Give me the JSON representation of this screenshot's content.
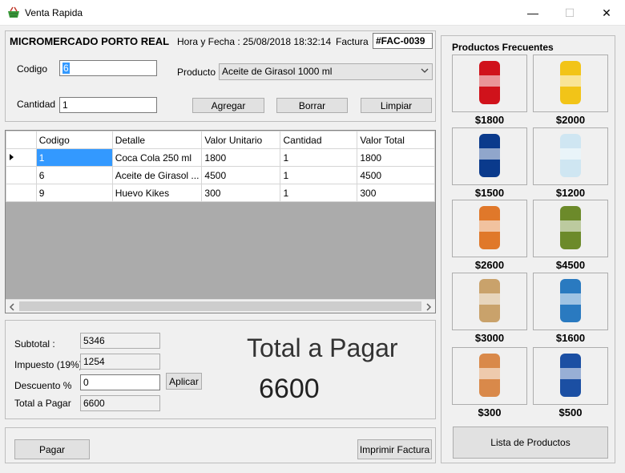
{
  "window": {
    "title": "Venta Rapida",
    "minimize": "—",
    "maximize": "☐",
    "close": "✕"
  },
  "header": {
    "store": "MICROMERCADO PORTO REAL",
    "datetime": "Hora  y Fecha : 25/08/2018 18:32:14",
    "invoice_label": "Factura",
    "invoice_number": "#FAC-0039"
  },
  "form": {
    "codigo_label": "Codigo",
    "codigo_value": "6",
    "cantidad_label": "Cantidad",
    "cantidad_value": "1",
    "producto_label": "Producto",
    "producto_value": "Aceite de Girasol 1000 ml"
  },
  "actions": {
    "agregar": "Agregar",
    "borrar": "Borrar",
    "limpiar": "Limpiar"
  },
  "table": {
    "columns": [
      "Codigo",
      "Detalle",
      "Valor Unitario",
      "Cantidad",
      "Valor Total"
    ],
    "rows": [
      [
        "1",
        "Coca Cola 250 ml",
        "1800",
        "1",
        "1800"
      ],
      [
        "6",
        "Aceite de Girasol ...",
        "4500",
        "1",
        "4500"
      ],
      [
        "9",
        "Huevo Kikes",
        "300",
        "1",
        "300"
      ]
    ]
  },
  "totals": {
    "subtotal_label": "Subtotal :",
    "subtotal": "5346",
    "impuesto_label": "Impuesto (19%)",
    "impuesto": "1254",
    "descuento_label": "Descuento %",
    "descuento": "0",
    "aplicar": "Aplicar",
    "total_label": "Total a Pagar",
    "total": "6600",
    "big_label": "Total a Pagar",
    "big_total": "6600"
  },
  "footer": {
    "pagar": "Pagar",
    "imprimir": "Imprimir Factura"
  },
  "frequent": {
    "title": "Productos Frecuentes",
    "list_button": "Lista de Productos",
    "items": [
      {
        "price": "$1800",
        "icon": "coca-cola-can-icon",
        "color": "#d0121b"
      },
      {
        "price": "$2000",
        "icon": "aguila-beer-can-icon",
        "color": "#f2c418"
      },
      {
        "price": "$1500",
        "icon": "pepsi-can-icon",
        "color": "#0a3a8c"
      },
      {
        "price": "$1200",
        "icon": "water-bottle-icon",
        "color": "#cfe6f2"
      },
      {
        "price": "$2600",
        "icon": "chips-bag-icon",
        "color": "#e0782a"
      },
      {
        "price": "$4500",
        "icon": "oil-bottle-icon",
        "color": "#6c8a2a"
      },
      {
        "price": "$3000",
        "icon": "bread-bag-icon",
        "color": "#c9a26b"
      },
      {
        "price": "$1600",
        "icon": "la-muneca-logo-icon",
        "color": "#2a7ac0"
      },
      {
        "price": "$300",
        "icon": "hen-eggs-icon",
        "color": "#d9894a"
      },
      {
        "price": "$500",
        "icon": "jet-chocolate-bar-icon",
        "color": "#1b4fa3"
      }
    ]
  }
}
